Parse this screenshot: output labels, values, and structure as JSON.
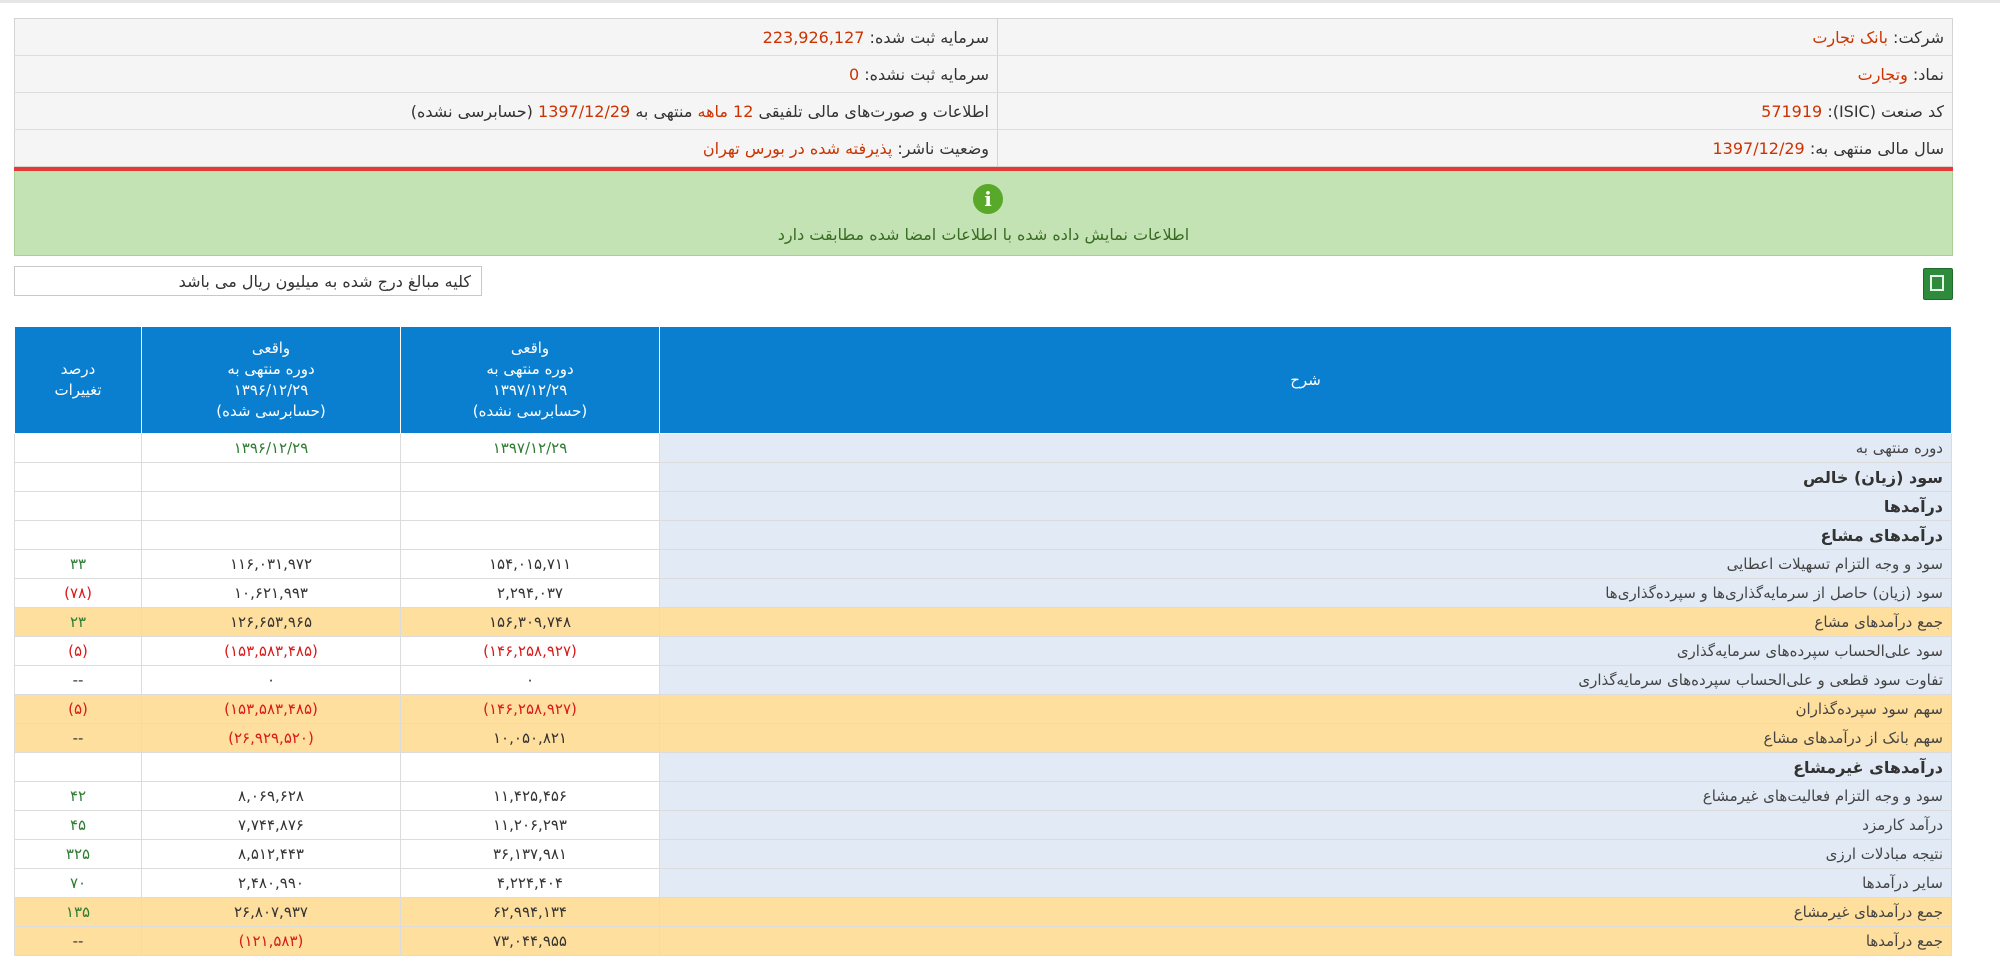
{
  "header": {
    "company_label": "شرکت:",
    "company": "بانک تجارت",
    "symbol_label": "نماد:",
    "symbol": "وتجارت",
    "isic_label": "کد صنعت (ISIC):",
    "isic": "571919",
    "fiscal_label": "سال مالی منتهی به:",
    "fiscal": "1397/12/29",
    "reg_capital_label": "سرمایه ثبت شده:",
    "reg_capital": "223,926,127",
    "unreg_capital_label": "سرمایه ثبت نشده:",
    "unreg_capital": "0",
    "report_pre": "اطلاعات و صورت‌های مالی تلفیقی",
    "report_period": "12 ماهه",
    "report_mid": "منتهی به",
    "report_date": "1397/12/29",
    "report_post": "(حسابرسی نشده)",
    "status_label": "وضعیت ناشر:",
    "status": "پذیرفته شده در بورس تهران"
  },
  "notice": {
    "icon": "i",
    "message": "اطلاعات نمایش داده شده با اطلاعات امضا شده مطابقت دارد"
  },
  "toolbar": {
    "unit_note": "کلیه مبالغ درج شده به میلیون ریال می باشد"
  },
  "table": {
    "headers": {
      "desc": "شرح",
      "col1": [
        "واقعی",
        "دوره منتهی به",
        "۱۳۹۷/۱۲/۲۹",
        "(حسابرسی نشده)"
      ],
      "col2": [
        "واقعی",
        "دوره منتهی به",
        "۱۳۹۶/۱۲/۲۹",
        "(حسابرسی شده)"
      ],
      "col3": [
        "درصد",
        "تغییرات"
      ]
    },
    "rows": [
      {
        "desc": "دوره منتهی به",
        "v1": "۱۳۹۷/۱۲/۲۹",
        "v2": "۱۳۹۶/۱۲/۲۹",
        "pct": "",
        "kind": "date"
      },
      {
        "desc": "سود (زیان) خالص",
        "v1": "",
        "v2": "",
        "pct": "",
        "kind": "head"
      },
      {
        "desc": "درآمدها",
        "v1": "",
        "v2": "",
        "pct": "",
        "kind": "head"
      },
      {
        "desc": "درآمدهای مشاع",
        "v1": "",
        "v2": "",
        "pct": "",
        "kind": "head"
      },
      {
        "desc": "سود و وجه التزام تسهیلات اعطایی",
        "v1": "۱۵۴,۰۱۵,۷۱۱",
        "v2": "۱۱۶,۰۳۱,۹۷۲",
        "pct": "۳۳",
        "kind": "row"
      },
      {
        "desc": "سود (زیان) حاصل از سرمایه‌گذاری‌ها و سپرده‌گذاری‌ها",
        "v1": "۲,۲۹۴,۰۳۷",
        "v2": "۱۰,۶۲۱,۹۹۳",
        "pct": "(۷۸)",
        "kind": "row"
      },
      {
        "desc": "جمع درآمدهای مشاع",
        "v1": "۱۵۶,۳۰۹,۷۴۸",
        "v2": "۱۲۶,۶۵۳,۹۶۵",
        "pct": "۲۳",
        "kind": "sum"
      },
      {
        "desc": "سود علی‌الحساب سپرده‌های سرمایه‌گذاری",
        "v1": "(۱۴۶,۲۵۸,۹۲۷)",
        "v2": "(۱۵۳,۵۸۳,۴۸۵)",
        "pct": "(۵)",
        "kind": "row"
      },
      {
        "desc": "تفاوت سود قطعی و علی‌الحساب سپرده‌های سرمایه‌گذاری",
        "v1": "۰",
        "v2": "۰",
        "pct": "--",
        "kind": "row"
      },
      {
        "desc": "سهم سود سپرده‌گذاران",
        "v1": "(۱۴۶,۲۵۸,۹۲۷)",
        "v2": "(۱۵۳,۵۸۳,۴۸۵)",
        "pct": "(۵)",
        "kind": "sum"
      },
      {
        "desc": "سهم بانک از درآمدهای مشاع",
        "v1": "۱۰,۰۵۰,۸۲۱",
        "v2": "(۲۶,۹۲۹,۵۲۰)",
        "pct": "--",
        "kind": "sum"
      },
      {
        "desc": "درآمدهای غیرمشاع",
        "v1": "",
        "v2": "",
        "pct": "",
        "kind": "head"
      },
      {
        "desc": "سود و وجه التزام فعالیت‌های غیرمشاع",
        "v1": "۱۱,۴۲۵,۴۵۶",
        "v2": "۸,۰۶۹,۶۲۸",
        "pct": "۴۲",
        "kind": "row"
      },
      {
        "desc": "درآمد کارمزد",
        "v1": "۱۱,۲۰۶,۲۹۳",
        "v2": "۷,۷۴۴,۸۷۶",
        "pct": "۴۵",
        "kind": "row"
      },
      {
        "desc": "نتیجه مبادلات ارزی",
        "v1": "۳۶,۱۳۷,۹۸۱",
        "v2": "۸,۵۱۲,۴۴۳",
        "pct": "۳۲۵",
        "kind": "row"
      },
      {
        "desc": "سایر درآمدها",
        "v1": "۴,۲۲۴,۴۰۴",
        "v2": "۲,۴۸۰,۹۹۰",
        "pct": "۷۰",
        "kind": "row"
      },
      {
        "desc": "جمع درآمدهای غیرمشاع",
        "v1": "۶۲,۹۹۴,۱۳۴",
        "v2": "۲۶,۸۰۷,۹۳۷",
        "pct": "۱۳۵",
        "kind": "sum"
      },
      {
        "desc": "جمع درآمدها",
        "v1": "۷۳,۰۴۴,۹۵۵",
        "v2": "(۱۲۱,۵۸۳)",
        "pct": "--",
        "kind": "sum"
      }
    ]
  }
}
